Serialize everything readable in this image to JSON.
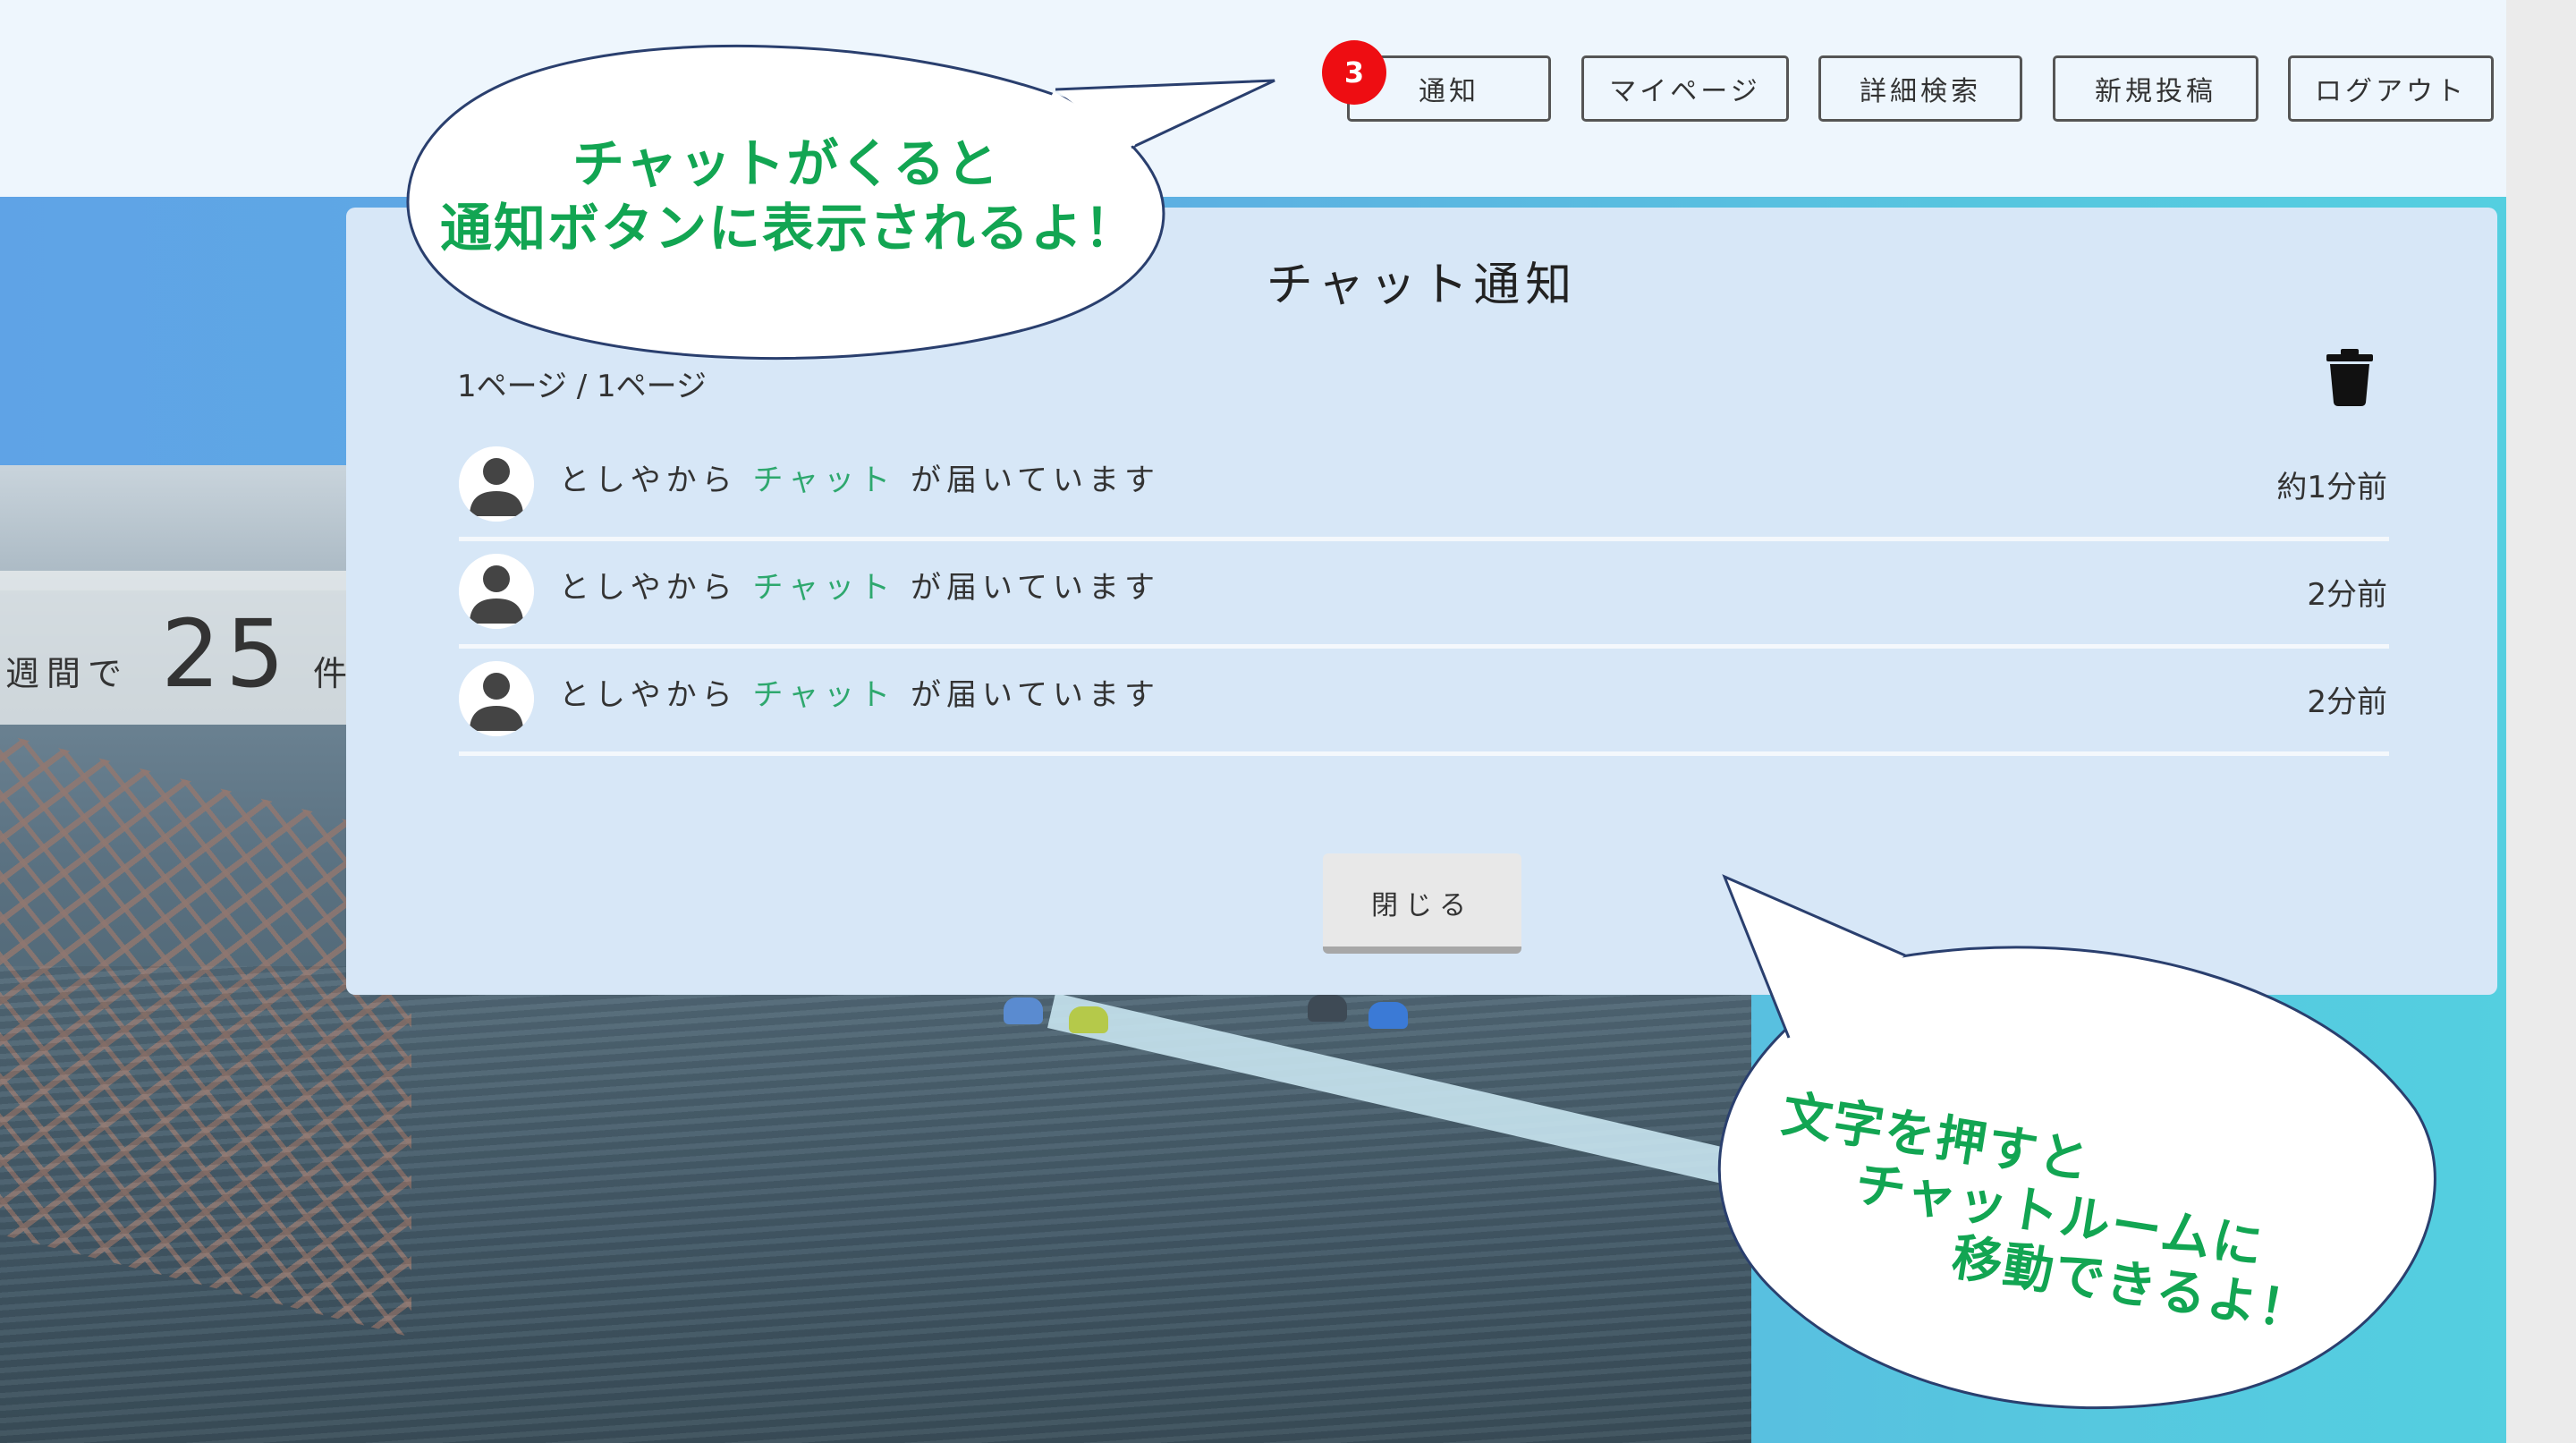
{
  "header": {
    "notification_count": "3",
    "buttons": [
      {
        "label": "通知"
      },
      {
        "label": "マイページ"
      },
      {
        "label": "詳細検索"
      },
      {
        "label": "新規投稿"
      },
      {
        "label": "ログアウト"
      }
    ]
  },
  "hero": {
    "week_prefix": "週間で",
    "week_count": "25",
    "week_suffix": "件"
  },
  "modal": {
    "title": "チャット通知",
    "page_info": "1ページ / 1ページ",
    "close_label": "閉じる",
    "notifications": [
      {
        "sender": "としやから",
        "link": "チャット",
        "suffix": "が届いています",
        "time": "約1分前"
      },
      {
        "sender": "としやから",
        "link": "チャット",
        "suffix": "が届いています",
        "time": "2分前"
      },
      {
        "sender": "としやから",
        "link": "チャット",
        "suffix": "が届いています",
        "time": "2分前"
      }
    ]
  },
  "callouts": {
    "notice": {
      "line1": "チャットがくると",
      "line2": "通知ボタンに表示されるよ！"
    },
    "move": {
      "line1": "文字を押すと",
      "line2": "チャットルームに",
      "line3": "移動できるよ！"
    }
  },
  "icons": {
    "trash": "trash-icon",
    "avatar": "user-avatar-icon"
  },
  "colors": {
    "accent_green": "#12a552",
    "link_green": "#2ea86e",
    "badge_red": "#ee0d12",
    "modal_bg": "#d7e7f7"
  }
}
